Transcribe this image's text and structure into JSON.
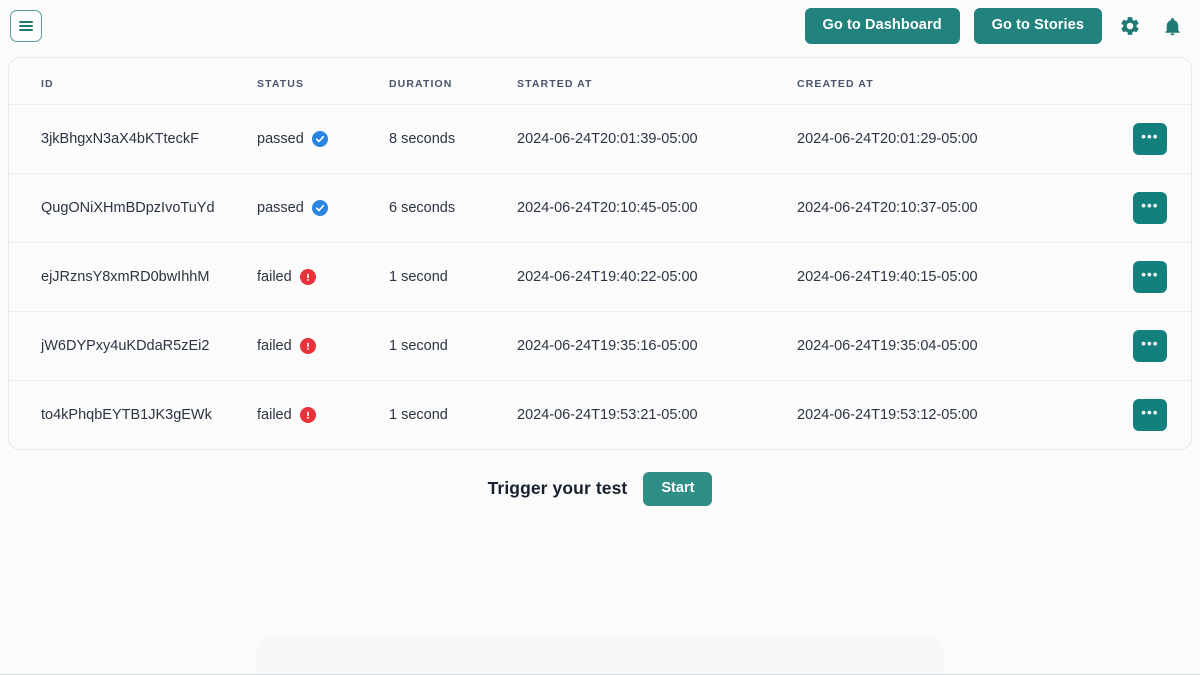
{
  "topbar": {
    "menu_icon": "hamburger-menu-icon",
    "dashboard_button": "Go to Dashboard",
    "stories_button": "Go to Stories",
    "settings_icon": "gear-icon",
    "notifications_icon": "bell-icon"
  },
  "table": {
    "columns": [
      "ID",
      "STATUS",
      "DURATION",
      "STARTED AT",
      "CREATED AT"
    ],
    "row_action_label": "•••",
    "rows": [
      {
        "id": "3jkBhgxN3aX4bKTteckF",
        "status": "passed",
        "status_icon": "check-circle-icon",
        "duration": "8 seconds",
        "started_at": "2024-06-24T20:01:39-05:00",
        "created_at": "2024-06-24T20:01:29-05:00"
      },
      {
        "id": "QugONiXHmBDpzIvoTuYd",
        "status": "passed",
        "status_icon": "check-circle-icon",
        "duration": "6 seconds",
        "started_at": "2024-06-24T20:10:45-05:00",
        "created_at": "2024-06-24T20:10:37-05:00"
      },
      {
        "id": "ejJRznsY8xmRD0bwIhhM",
        "status": "failed",
        "status_icon": "error-circle-icon",
        "duration": "1 second",
        "started_at": "2024-06-24T19:40:22-05:00",
        "created_at": "2024-06-24T19:40:15-05:00"
      },
      {
        "id": "jW6DYPxy4uKDdaR5zEi2",
        "status": "failed",
        "status_icon": "error-circle-icon",
        "duration": "1 second",
        "started_at": "2024-06-24T19:35:16-05:00",
        "created_at": "2024-06-24T19:35:04-05:00"
      },
      {
        "id": "to4kPhqbEYTB1JK3gEWk",
        "status": "failed",
        "status_icon": "error-circle-icon",
        "duration": "1 second",
        "started_at": "2024-06-24T19:53:21-05:00",
        "created_at": "2024-06-24T19:53:12-05:00"
      }
    ]
  },
  "trigger": {
    "label": "Trigger your test",
    "start_button": "Start"
  },
  "colors": {
    "teal": "#22827d",
    "teal_dark": "#14807d",
    "teal_start": "#2f8f86",
    "pass_blue": "#2a85e0",
    "fail_red": "#e8313a",
    "background": "#fbfbfb",
    "border": "#e4e7ec"
  }
}
